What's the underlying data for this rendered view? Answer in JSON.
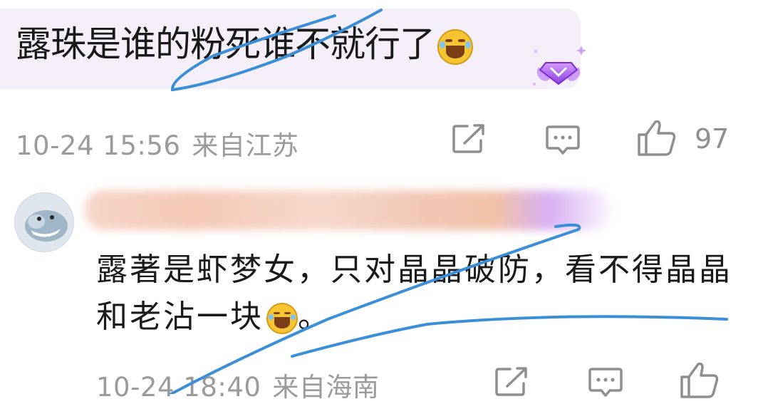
{
  "comments": [
    {
      "text": "露珠是谁的粉死谁不就行了",
      "time": "10-24 15:56",
      "location": "来自江苏",
      "likes": "97",
      "emoji": "laugh-cry-emoji",
      "badge": "purple-diamond-badge"
    },
    {
      "text": "露著是虾梦女，只对晶晶破防，看不得晶晶和老沾一块",
      "text_tail": "。",
      "time": "10-24 18:40",
      "location": "来自海南",
      "emoji": "laugh-cry-emoji"
    }
  ],
  "colors": {
    "bubble": "#f4eff8",
    "meta_text": "#9b9b9b",
    "pen_stroke": "#3b8fd9",
    "badge": "#b36cf0"
  }
}
